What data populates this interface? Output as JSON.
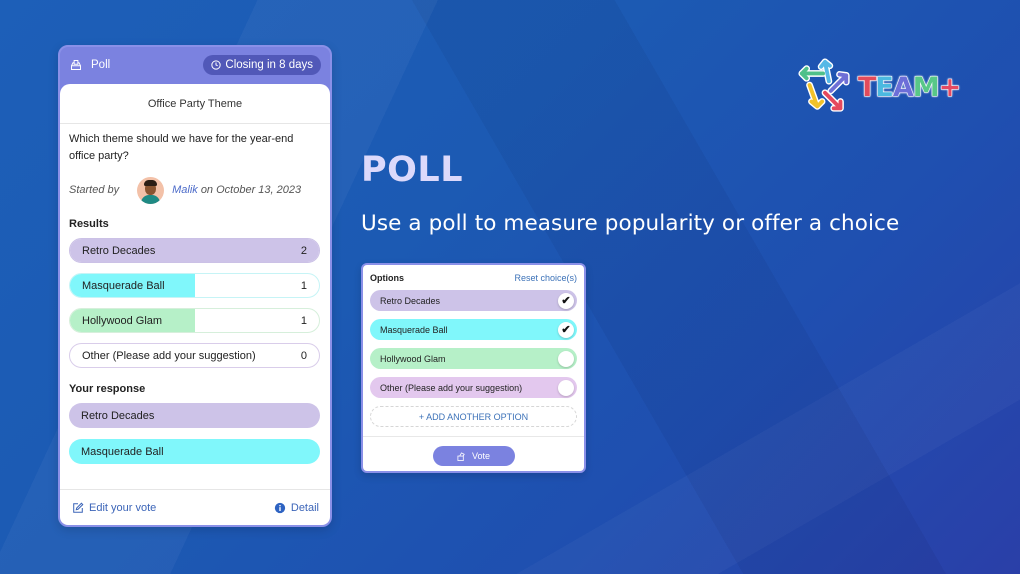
{
  "poll_card": {
    "header": {
      "type_label": "Poll",
      "type_icon": "ballot-box-icon",
      "closing_label": "Closing in 8 days",
      "closing_icon": "clock-icon"
    },
    "title": "Office Party Theme",
    "question": "Which theme should we have for the year-end office party?",
    "started_by_label": "Started by",
    "author": "Malik",
    "date_text": "on October 13, 2023",
    "results_label": "Results",
    "results": [
      {
        "label": "Retro Decades",
        "count": "2",
        "fraction": 1.0,
        "color": "#cdc3e8"
      },
      {
        "label": "Masquerade Ball",
        "count": "1",
        "fraction": 0.5,
        "color": "#80f7fb"
      },
      {
        "label": "Hollywood Glam",
        "count": "1",
        "fraction": 0.5,
        "color": "#b6f0c8"
      },
      {
        "label": "Other (Please add your suggestion)",
        "count": "0",
        "fraction": 0.0,
        "color": "#e3c8ee"
      }
    ],
    "response_label": "Your response",
    "responses": [
      {
        "label": "Retro Decades",
        "color": "#cdc3e8"
      },
      {
        "label": "Masquerade Ball",
        "color": "#80f7fb"
      }
    ],
    "footer": {
      "edit_label": "Edit your vote",
      "edit_icon": "edit-icon",
      "detail_label": "Detail",
      "detail_icon": "info-icon"
    }
  },
  "logo": {
    "text": [
      "T",
      "E",
      "A",
      "M",
      "+"
    ]
  },
  "headline": "POLL",
  "subhead": "Use a poll to measure popularity or offer a choice",
  "options_card": {
    "label": "Options",
    "reset_label": "Reset choice(s)",
    "options": [
      {
        "label": "Retro Decades",
        "checked": true,
        "color": "#cdc3e8"
      },
      {
        "label": "Masquerade Ball",
        "checked": true,
        "color": "#80f7fb"
      },
      {
        "label": "Hollywood Glam",
        "checked": false,
        "color": "#b6f0c8"
      },
      {
        "label": "Other (Please add your suggestion)",
        "checked": false,
        "color": "#e3c8ee"
      }
    ],
    "add_option_label": "+ ADD ANOTHER OPTION",
    "vote_label": "Vote",
    "vote_icon": "hand-vote-icon"
  }
}
